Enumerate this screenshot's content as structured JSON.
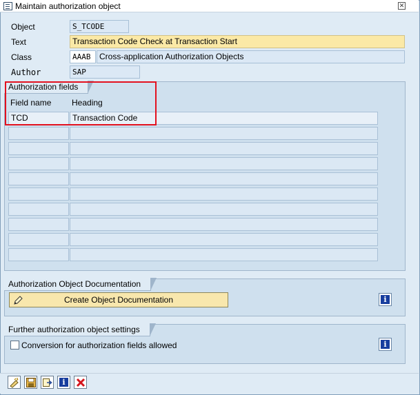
{
  "window": {
    "title": "Maintain authorization object"
  },
  "header_fields": {
    "object": {
      "label": "Object",
      "value": "S_TCODE"
    },
    "text": {
      "label": "Text",
      "value": "Transaction Code Check at Transaction Start"
    },
    "class": {
      "label": "Class",
      "code": "AAAB",
      "description": "Cross-application Authorization Objects"
    },
    "author": {
      "label": "Author",
      "value": "SAP"
    }
  },
  "auth_fields": {
    "group_title": "Authorization fields",
    "columns": [
      "Field name",
      "Heading"
    ],
    "rows": [
      [
        "TCD",
        "Transaction Code"
      ],
      [
        "",
        ""
      ],
      [
        "",
        ""
      ],
      [
        "",
        ""
      ],
      [
        "",
        ""
      ],
      [
        "",
        ""
      ],
      [
        "",
        ""
      ],
      [
        "",
        ""
      ],
      [
        "",
        ""
      ],
      [
        "",
        ""
      ]
    ]
  },
  "documentation": {
    "group_title": "Authorization Object Documentation",
    "create_button": "Create Object Documentation",
    "info_icon": "info-icon"
  },
  "settings": {
    "group_title": "Further authorization object settings",
    "checkbox_label": "Conversion for authorization fields allowed",
    "checkbox_checked": false,
    "info_icon": "info-icon"
  },
  "toolbar": {
    "buttons": [
      "check-icon",
      "save-icon",
      "navigate-icon",
      "info-icon",
      "cancel-icon"
    ]
  },
  "colors": {
    "background": "#dfebf5",
    "group_fill": "#cfe0ee",
    "required_field": "#fbe9a6",
    "highlight_box": "#e3101e",
    "info_blue": "#173d9e"
  }
}
